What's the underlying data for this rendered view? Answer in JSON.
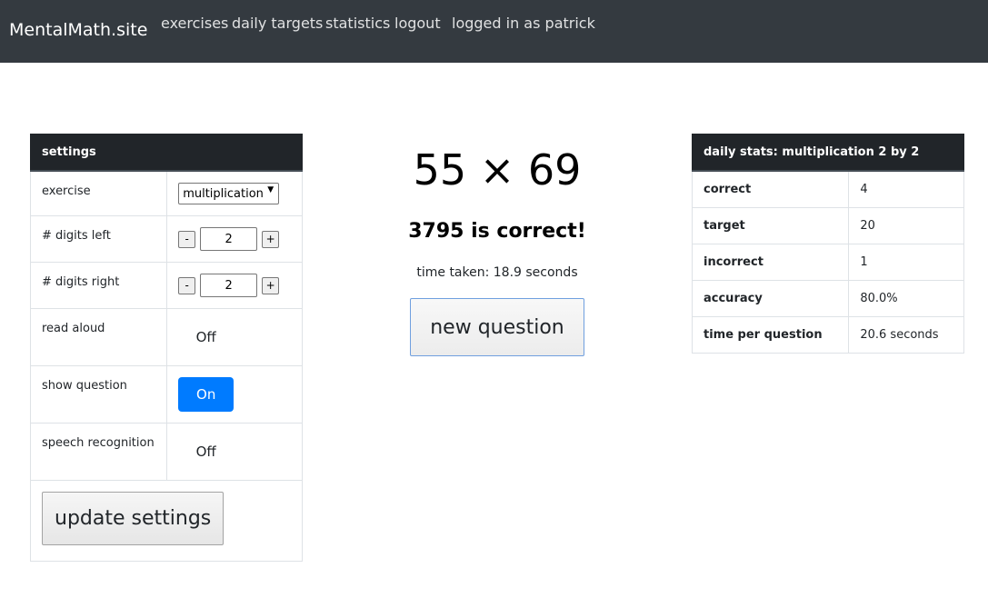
{
  "nav": {
    "brand": "MentalMath.site",
    "links": [
      "exercises",
      "daily targets",
      "statistics",
      "logout",
      "logged in as patrick"
    ]
  },
  "settings": {
    "title": "settings",
    "exercise_label": "exercise",
    "exercise_value": "multiplication",
    "digits_left_label": "# digits left",
    "digits_left_value": "2",
    "digits_right_label": "# digits right",
    "digits_right_value": "2",
    "read_aloud_label": "read aloud",
    "read_aloud_state": "Off",
    "show_question_label": "show question",
    "show_question_state": "On",
    "speech_label": "speech recognition",
    "speech_state": "Off",
    "minus": "-",
    "plus": "+",
    "update_label": "update settings"
  },
  "exercise": {
    "question": "55 × 69",
    "result": "3795 is correct!",
    "time_taken": "time taken: 18.9 seconds",
    "new_question_label": "new question"
  },
  "stats": {
    "title": "daily stats: multiplication 2 by 2",
    "rows": [
      {
        "key": "correct",
        "value": "4"
      },
      {
        "key": "target",
        "value": "20"
      },
      {
        "key": "incorrect",
        "value": "1"
      },
      {
        "key": "accuracy",
        "value": "80.0%"
      },
      {
        "key": "time per question",
        "value": "20.6 seconds"
      }
    ]
  },
  "colors": {
    "navbar": "#343a40",
    "table_head": "#212529",
    "toggle_on": "#007bff"
  }
}
